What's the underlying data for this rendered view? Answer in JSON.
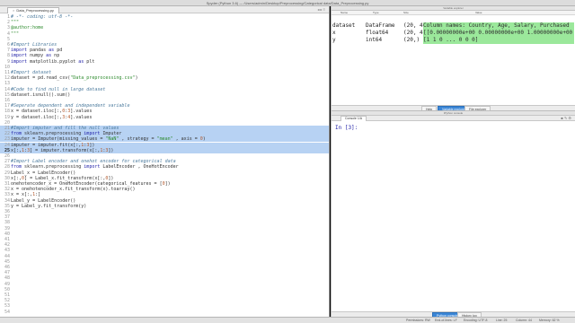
{
  "window": {
    "title": "Spyder (Python 3.6) — /Users/admin/Desktop/Preprocessing/Categorical data/Data_Preprocessing.py"
  },
  "editor": {
    "tab_label": "Data_Preprocessing.py",
    "tab_close": "×",
    "tab_arrows": "◂ ▸ ≡",
    "lines": [
      {
        "n": "1",
        "segs": [
          [
            "c-com",
            "# -*- coding: utf-8 -*-"
          ]
        ]
      },
      {
        "n": "2",
        "segs": [
          [
            "c-str",
            "\"\"\""
          ]
        ]
      },
      {
        "n": "3",
        "segs": [
          [
            "c-str",
            "@author:home"
          ]
        ]
      },
      {
        "n": "4",
        "segs": [
          [
            "c-str",
            "\"\"\""
          ]
        ]
      },
      {
        "n": "5",
        "segs": []
      },
      {
        "n": "6",
        "segs": [
          [
            "c-com",
            "#Import Libraries"
          ]
        ]
      },
      {
        "n": "7",
        "segs": [
          [
            "c-kw",
            "import"
          ],
          [
            "c-def",
            " pandas "
          ],
          [
            "c-kw",
            "as"
          ],
          [
            "c-def",
            " pd"
          ]
        ]
      },
      {
        "n": "8",
        "segs": [
          [
            "c-kw",
            "import"
          ],
          [
            "c-def",
            " numpy "
          ],
          [
            "c-kw",
            "as"
          ],
          [
            "c-def",
            " np"
          ]
        ]
      },
      {
        "n": "9",
        "segs": [
          [
            "c-kw",
            "import"
          ],
          [
            "c-def",
            " matplotlib.pyplot "
          ],
          [
            "c-kw",
            "as"
          ],
          [
            "c-def",
            " plt"
          ]
        ]
      },
      {
        "n": "10",
        "segs": []
      },
      {
        "n": "11",
        "segs": [
          [
            "c-com",
            "#Import dataset"
          ]
        ]
      },
      {
        "n": "12",
        "segs": [
          [
            "c-def",
            "dataset = pd.read_csv("
          ],
          [
            "c-str",
            "\"Data_preprocessing.csv\""
          ],
          [
            "c-def",
            ")"
          ]
        ]
      },
      {
        "n": "13",
        "segs": []
      },
      {
        "n": "14",
        "segs": [
          [
            "c-com",
            "#Code to find null in large dataset"
          ]
        ]
      },
      {
        "n": "15",
        "segs": [
          [
            "c-def",
            "dataset.isnull().sum()"
          ]
        ]
      },
      {
        "n": "16",
        "segs": []
      },
      {
        "n": "17",
        "segs": [
          [
            "c-com",
            "#Seperate dependent and independent variable"
          ]
        ]
      },
      {
        "n": "18",
        "segs": [
          [
            "c-def",
            "x = dataset.iloc[:,"
          ],
          [
            "c-num",
            "0"
          ],
          [
            "c-def",
            ":"
          ],
          [
            "c-num",
            "3"
          ],
          [
            "c-def",
            "].values"
          ]
        ]
      },
      {
        "n": "19",
        "segs": [
          [
            "c-def",
            "y = dataset.iloc[:,"
          ],
          [
            "c-num",
            "3"
          ],
          [
            "c-def",
            ":"
          ],
          [
            "c-num",
            "4"
          ],
          [
            "c-def",
            "].values"
          ]
        ]
      },
      {
        "n": "20",
        "segs": []
      },
      {
        "n": "21",
        "hl": true,
        "segs": [
          [
            "c-com",
            "#Import imputer and fill the null values"
          ]
        ]
      },
      {
        "n": "22",
        "hl": true,
        "segs": [
          [
            "c-kw",
            "from"
          ],
          [
            "c-def",
            " sklearn.preprocessing "
          ],
          [
            "c-kw",
            "import"
          ],
          [
            "c-def",
            " Imputer"
          ]
        ]
      },
      {
        "n": "23",
        "hl": true,
        "segs": [
          [
            "c-def",
            "imputer = Imputer(missing_values = "
          ],
          [
            "c-str",
            "\"NaN\""
          ],
          [
            "c-def",
            " , strategy = "
          ],
          [
            "c-str",
            "\"mean\""
          ],
          [
            "c-def",
            " , axis = "
          ],
          [
            "c-num",
            "0"
          ],
          [
            "c-def",
            ")"
          ]
        ]
      },
      {
        "n": "24",
        "hl": true,
        "segs": [
          [
            "c-def",
            "imputer = imputer.fit(x[:,"
          ],
          [
            "c-num",
            "1"
          ],
          [
            "c-def",
            ":"
          ],
          [
            "c-num",
            "3"
          ],
          [
            "c-def",
            "])"
          ]
        ]
      },
      {
        "n": "25",
        "hl": true,
        "current": true,
        "segs": [
          [
            "c-def",
            "x[:,"
          ],
          [
            "c-num",
            "1"
          ],
          [
            "c-def",
            ":"
          ],
          [
            "c-num",
            "3"
          ],
          [
            "c-def",
            "] = imputer.transform(x[:,"
          ],
          [
            "c-num",
            "1"
          ],
          [
            "c-def",
            ":"
          ],
          [
            "c-num",
            "3"
          ],
          [
            "c-def",
            "])"
          ]
        ]
      },
      {
        "n": "26",
        "segs": []
      },
      {
        "n": "27",
        "segs": [
          [
            "c-com",
            "#Import Label encoder and onehot encoder for categorical data"
          ]
        ]
      },
      {
        "n": "28",
        "segs": [
          [
            "c-kw",
            "from"
          ],
          [
            "c-def",
            " sklearn.preprocessing "
          ],
          [
            "c-kw",
            "import"
          ],
          [
            "c-def",
            " LabelEncoder , OneHotEncoder"
          ]
        ]
      },
      {
        "n": "29",
        "segs": [
          [
            "c-def",
            "Label_x = LabelEncoder()"
          ]
        ]
      },
      {
        "n": "30",
        "segs": [
          [
            "c-def",
            "x[:,"
          ],
          [
            "c-num",
            "0"
          ],
          [
            "c-def",
            "] = Label_x.fit_transform(x[:,"
          ],
          [
            "c-num",
            "0"
          ],
          [
            "c-def",
            "])"
          ]
        ]
      },
      {
        "n": "31",
        "segs": [
          [
            "c-def",
            "onehotencoder_x = OneHotEncoder(categorical_features = ["
          ],
          [
            "c-num",
            "0"
          ],
          [
            "c-def",
            "])"
          ]
        ]
      },
      {
        "n": "32",
        "segs": [
          [
            "c-def",
            "x = onehotencoder_x.fit_transform(x).toarray()"
          ]
        ]
      },
      {
        "n": "33",
        "segs": [
          [
            "c-def",
            "x = x[:,"
          ],
          [
            "c-num",
            "1"
          ],
          [
            "c-def",
            ":]"
          ]
        ]
      },
      {
        "n": "34",
        "segs": [
          [
            "c-def",
            "Label_y = LabelEncoder()"
          ]
        ]
      },
      {
        "n": "35",
        "segs": [
          [
            "c-def",
            "y = Label_y.fit_transform(y)"
          ]
        ]
      },
      {
        "n": "36",
        "segs": []
      },
      {
        "n": "37",
        "segs": []
      },
      {
        "n": "38",
        "segs": []
      },
      {
        "n": "39",
        "segs": []
      },
      {
        "n": "40",
        "segs": []
      },
      {
        "n": "41",
        "segs": []
      },
      {
        "n": "42",
        "segs": []
      },
      {
        "n": "43",
        "segs": []
      },
      {
        "n": "44",
        "segs": []
      },
      {
        "n": "45",
        "segs": []
      },
      {
        "n": "46",
        "segs": []
      },
      {
        "n": "47",
        "segs": []
      },
      {
        "n": "48",
        "segs": []
      },
      {
        "n": "49",
        "segs": []
      },
      {
        "n": "50",
        "segs": []
      },
      {
        "n": "51",
        "segs": []
      },
      {
        "n": "52",
        "segs": []
      },
      {
        "n": "53",
        "segs": []
      },
      {
        "n": "54",
        "segs": []
      }
    ]
  },
  "variable_explorer": {
    "header": "Variable explorer",
    "columns": [
      "Name",
      "Type",
      "Size",
      "Value"
    ],
    "rows": [
      {
        "name": "dataset",
        "type": "DataFrame",
        "size": "(20, 4)",
        "value": "Column names: Country, Age, Salary, Purchased",
        "green": true
      },
      {
        "name": "x",
        "type": "float64",
        "size": "(20, 4)",
        "value": "[[0.00000000e+00 0.00000000e+00 1.00000000e+00 ...",
        "green": true
      },
      {
        "name": "y",
        "type": "int64",
        "size": "(20,)",
        "value": "[1 1 0 ... 0 0 0]",
        "green": true
      }
    ],
    "tabs": [
      "Help",
      "Variable explorer",
      "File explorer"
    ],
    "active_tab": 1
  },
  "console": {
    "header": "IPython console",
    "tab_label": "Console 1/A",
    "tools": "■ ✎ ⚙",
    "prompt": "In [3]:",
    "tabs": [
      "Python console",
      "History log"
    ],
    "active_tab": 0
  },
  "status": {
    "permissions": "Permissions: RW",
    "eol": "End-of-lines: LF",
    "encoding": "Encoding: UTF-8",
    "line": "Line: 25",
    "column": "Column: 44",
    "memory": "Memory: 62 %"
  }
}
